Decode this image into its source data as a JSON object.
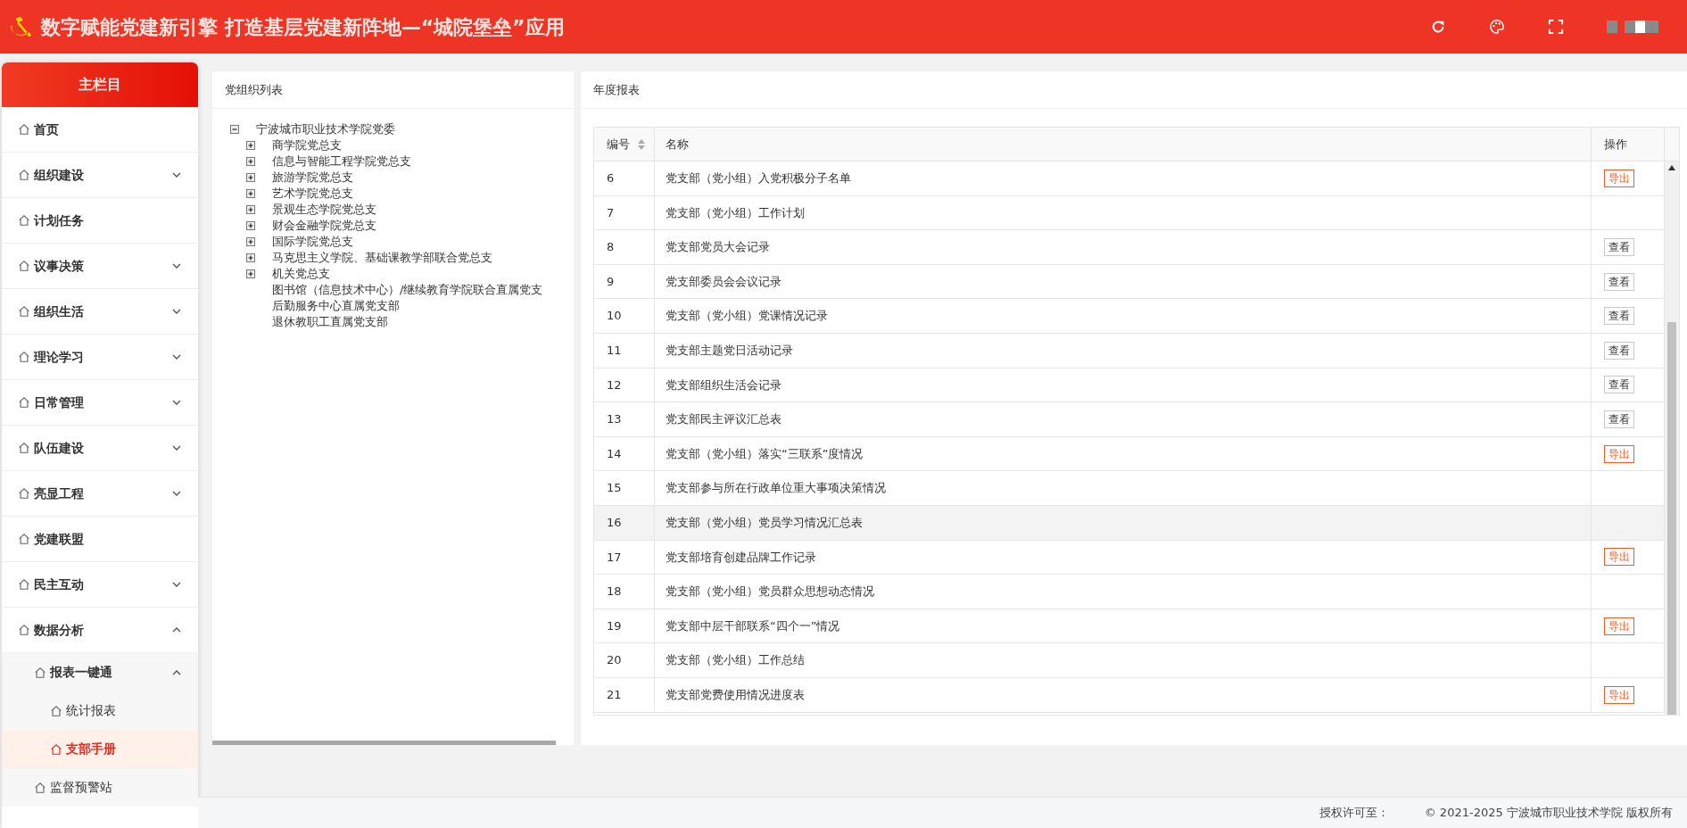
{
  "header": {
    "title": "数字赋能党建新引擎 打造基层党建新阵地—“城院堡垒”应用"
  },
  "sidebar": {
    "title": "主栏目",
    "items": [
      {
        "label": "首页",
        "kind": "link",
        "selected": false
      },
      {
        "label": "组织建设",
        "kind": "group",
        "expanded": false,
        "selected": false
      },
      {
        "label": "计划任务",
        "kind": "link",
        "selected": false
      },
      {
        "label": "议事决策",
        "kind": "group",
        "expanded": false,
        "selected": false
      },
      {
        "label": "组织生活",
        "kind": "group",
        "expanded": false,
        "selected": false
      },
      {
        "label": "理论学习",
        "kind": "group",
        "expanded": false,
        "selected": false
      },
      {
        "label": "日常管理",
        "kind": "group",
        "expanded": false,
        "selected": false
      },
      {
        "label": "队伍建设",
        "kind": "group",
        "expanded": false,
        "selected": false
      },
      {
        "label": "亮显工程",
        "kind": "group",
        "expanded": false,
        "selected": false
      },
      {
        "label": "党建联盟",
        "kind": "link",
        "selected": false
      },
      {
        "label": "民主互动",
        "kind": "group",
        "expanded": false,
        "selected": false
      },
      {
        "label": "数据分析",
        "kind": "group",
        "expanded": true,
        "selected": false,
        "children": [
          {
            "label": "报表一键通",
            "kind": "group",
            "expanded": true,
            "selected": false,
            "children": [
              {
                "label": "统计报表",
                "kind": "link",
                "selected": false
              },
              {
                "label": "支部手册",
                "kind": "link",
                "selected": true
              }
            ]
          },
          {
            "label": "监督预警站",
            "kind": "link",
            "selected": false
          }
        ]
      }
    ]
  },
  "org_panel": {
    "title": "党组织列表",
    "tree": [
      {
        "label": "宁波城市职业技术学院党委",
        "kind": "folder",
        "expanded": true,
        "children": [
          {
            "label": "商学院党总支",
            "kind": "folder",
            "expanded": false
          },
          {
            "label": "信息与智能工程学院党总支",
            "kind": "folder",
            "expanded": false
          },
          {
            "label": "旅游学院党总支",
            "kind": "folder",
            "expanded": false
          },
          {
            "label": "艺术学院党总支",
            "kind": "folder",
            "expanded": false
          },
          {
            "label": "景观生态学院党总支",
            "kind": "folder",
            "expanded": false
          },
          {
            "label": "财会金融学院党总支",
            "kind": "folder",
            "expanded": false
          },
          {
            "label": "国际学院党总支",
            "kind": "folder",
            "expanded": false
          },
          {
            "label": "马克思主义学院、基础课教学部联合党总支",
            "kind": "folder",
            "expanded": false
          },
          {
            "label": "机关党总支",
            "kind": "folder",
            "expanded": false
          },
          {
            "label": "图书馆（信息技术中心）/继续教育学院联合直属党支",
            "kind": "leaf"
          },
          {
            "label": "后勤服务中心直属党支部",
            "kind": "leaf"
          },
          {
            "label": "退休教职工直属党支部",
            "kind": "leaf"
          }
        ]
      }
    ]
  },
  "report_panel": {
    "title": "年度报表",
    "table": {
      "columns": [
        "编号",
        "名称",
        "操作"
      ],
      "rows": [
        {
          "number": "6",
          "name": "党支部（党小组）入党积极分子名单",
          "action": {
            "label": "导出",
            "kind": "export"
          },
          "highlighted": false
        },
        {
          "number": "7",
          "name": "党支部（党小组）工作计划",
          "highlighted": false
        },
        {
          "number": "8",
          "name": "党支部党员大会记录",
          "action": {
            "label": "查看",
            "kind": "view"
          },
          "highlighted": false
        },
        {
          "number": "9",
          "name": "党支部委员会会议记录",
          "action": {
            "label": "查看",
            "kind": "view"
          },
          "highlighted": false
        },
        {
          "number": "10",
          "name": "党支部（党小组）党课情况记录",
          "action": {
            "label": "查看",
            "kind": "view"
          },
          "highlighted": false
        },
        {
          "number": "11",
          "name": "党支部主题党日活动记录",
          "action": {
            "label": "查看",
            "kind": "view"
          },
          "highlighted": false
        },
        {
          "number": "12",
          "name": "党支部组织生活会记录",
          "action": {
            "label": "查看",
            "kind": "view"
          },
          "highlighted": false
        },
        {
          "number": "13",
          "name": "党支部民主评议汇总表",
          "action": {
            "label": "查看",
            "kind": "view"
          },
          "highlighted": false
        },
        {
          "number": "14",
          "name": "党支部（党小组）落实“三联系”度情况",
          "action": {
            "label": "导出",
            "kind": "export"
          },
          "highlighted": false
        },
        {
          "number": "15",
          "name": "党支部参与所在行政单位重大事项决策情况",
          "highlighted": false
        },
        {
          "number": "16",
          "name": "党支部（党小组）党员学习情况汇总表",
          "highlighted": true
        },
        {
          "number": "17",
          "name": "党支部培育创建品牌工作记录",
          "action": {
            "label": "导出",
            "kind": "export"
          },
          "highlighted": false
        },
        {
          "number": "18",
          "name": "党支部（党小组）党员群众思想动态情况",
          "highlighted": false
        },
        {
          "number": "19",
          "name": "党支部中层干部联系“四个一”情况",
          "action": {
            "label": "导出",
            "kind": "export"
          },
          "highlighted": false
        },
        {
          "number": "20",
          "name": "党支部（党小组）工作总结",
          "highlighted": false
        },
        {
          "number": "21",
          "name": "党支部党费使用情况进度表",
          "action": {
            "label": "导出",
            "kind": "export"
          },
          "highlighted": false
        }
      ]
    }
  },
  "footer": {
    "license": "授权许可至：",
    "copyright": "© 2021-2025 宁波城市职业技术学院 版权所有"
  }
}
